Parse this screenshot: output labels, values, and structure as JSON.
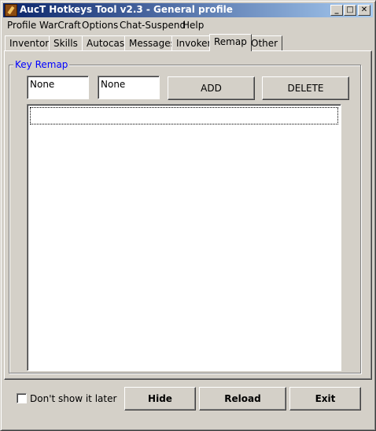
{
  "window": {
    "title": "AucT Hotkeys Tool v2.3 - General profile",
    "icon": "app-icon",
    "caption_buttons": [
      "minimize",
      "maximize",
      "close"
    ]
  },
  "menu": [
    "Profile",
    "WarCraft",
    "Options",
    "Chat-Suspend",
    "Help"
  ],
  "tabs": [
    "Inventory",
    "Skills",
    "Autocast",
    "Messages",
    "Invoker",
    "Remap",
    "Other"
  ],
  "active_tab": "Remap",
  "group": {
    "title": "Key Remap",
    "from_key_value": "None",
    "to_key_value": "None",
    "add_label": "ADD",
    "delete_label": "DELETE"
  },
  "footer": {
    "checkbox_label": "Don't show it later",
    "checkbox_checked": false,
    "hide_label": "Hide",
    "reload_label": "Reload",
    "exit_label": "Exit"
  }
}
